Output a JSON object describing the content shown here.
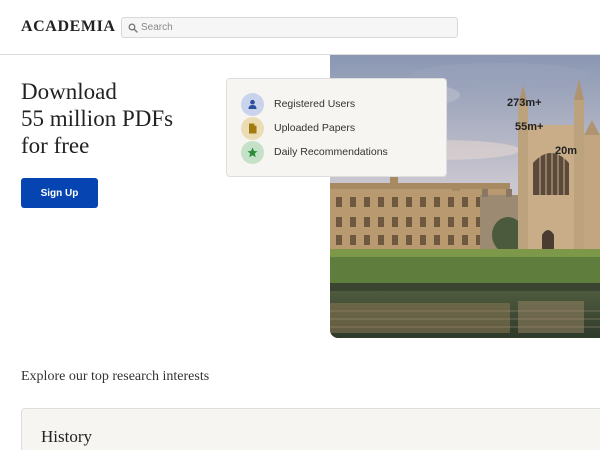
{
  "header": {
    "logo": "ACADEMIA",
    "search_placeholder": "Search"
  },
  "hero": {
    "title_lines": [
      "Download",
      "55 million PDFs",
      "for free"
    ],
    "signup_label": "Sign Up"
  },
  "stats_card": {
    "items": [
      {
        "label": "Registered Users",
        "icon": "user-icon",
        "color": "#c9d3ec",
        "icon_color": "#2b4e9e"
      },
      {
        "label": "Uploaded Papers",
        "icon": "document-icon",
        "color": "#ecdcb4",
        "icon_color": "#a27a12"
      },
      {
        "label": "Daily Recommendations",
        "icon": "star-icon",
        "color": "#c5e2c8",
        "icon_color": "#2c8a3a"
      }
    ]
  },
  "stat_numbers": [
    "273m+",
    "55m+",
    "20m"
  ],
  "explore": {
    "heading": "Explore our top research interests",
    "topics": [
      {
        "title": "History"
      }
    ]
  },
  "colors": {
    "brand_blue": "#0645b1",
    "card_bg": "#f7f5f2"
  }
}
